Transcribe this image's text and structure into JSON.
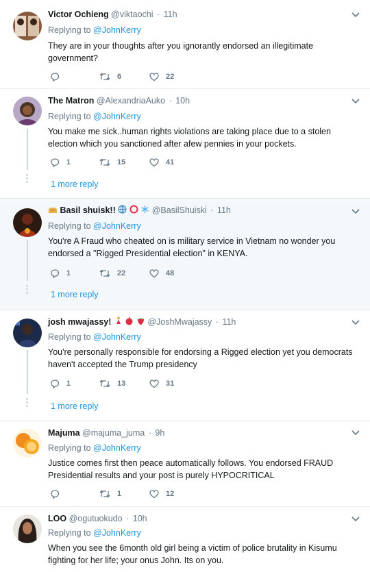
{
  "replying_label": "Replying to",
  "more_reply_label": "1 more reply",
  "tweets": [
    {
      "name": "Victor Ochieng",
      "handle": "@viktaochi",
      "time": "11h",
      "reply_to": "@JohnKerry",
      "text": "They are in your thoughts after you ignorantly endorsed an illegitimate government?",
      "replies": "",
      "retweets": "6",
      "likes": "22"
    },
    {
      "name": "The Matron",
      "handle": "@AlexandriaAuko",
      "time": "10h",
      "reply_to": "@JohnKerry",
      "text": "You make me sick..human rights violations are taking place due to a stolen election which you sanctioned after afew pennies in your pockets.",
      "replies": "1",
      "retweets": "15",
      "likes": "41"
    },
    {
      "name": "Basil shuisk!!",
      "handle": "@BasilShuiski",
      "time": "11h",
      "reply_to": "@JohnKerry",
      "text": "You're A Fraud who cheated on is military service in Vietnam no wonder you endorsed a \"Rigged Presidential election\" in KENYA.",
      "replies": "1",
      "retweets": "22",
      "likes": "48"
    },
    {
      "name": "josh mwajassy!",
      "handle": "@JoshMwajassy",
      "time": "11h",
      "reply_to": "@JohnKerry",
      "text": "You're personally responsible for endorsing a Rigged election yet you democrats haven't accepted the Trump presidency",
      "replies": "1",
      "retweets": "13",
      "likes": "31"
    },
    {
      "name": "Majuma",
      "handle": "@majuma_juma",
      "time": "9h",
      "reply_to": "@JohnKerry",
      "text": "Justice comes first then peace automatically follows. You endorsed FRAUD Presidential results and  your post is purely HYPOCRITICAL",
      "replies": "",
      "retweets": "1",
      "likes": "12"
    },
    {
      "name": "LOO",
      "handle": "@ogutuokudo",
      "time": "10h",
      "reply_to": "@JohnKerry",
      "text": "When you see the 6month old girl being a victim of police brutality in Kisumu fighting for her life; your onus John. Its on you.",
      "replies": "",
      "retweets": "",
      "likes": ""
    }
  ],
  "icons": {
    "reply": "reply-icon",
    "retweet": "retweet-icon",
    "like": "heart-icon",
    "more": "chevron-down-icon"
  },
  "colors": {
    "link": "#1b95e0",
    "muted": "#657786",
    "highlight_bg": "#f5f8fa"
  }
}
